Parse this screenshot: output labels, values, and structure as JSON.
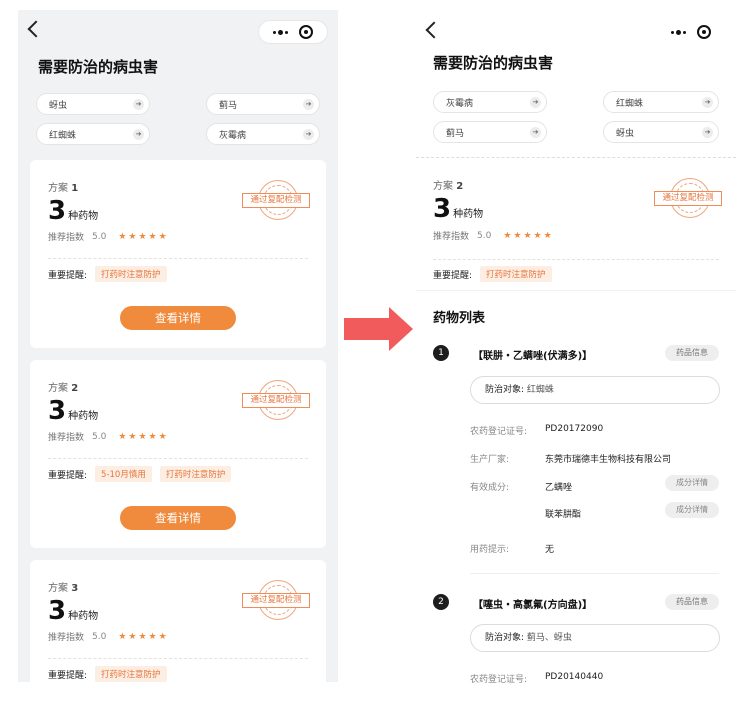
{
  "title": "需要防治的病虫害",
  "left": {
    "chips": [
      "蚜虫",
      "蓟马",
      "红蜘蛛",
      "灰霉病"
    ],
    "plans": [
      {
        "label": "方案",
        "num": "1",
        "count": "3",
        "unit": "种药物",
        "score_label": "推荐指数",
        "score": "5.0",
        "stars": "★★★★★",
        "remind_label": "重要提醒:",
        "tags": [
          "打药时注意防护"
        ],
        "stamp": "通过复配检测",
        "button": "查看详情"
      },
      {
        "label": "方案",
        "num": "2",
        "count": "3",
        "unit": "种药物",
        "score_label": "推荐指数",
        "score": "5.0",
        "stars": "★★★★★",
        "remind_label": "重要提醒:",
        "tags": [
          "5-10月慎用",
          "打药时注意防护"
        ],
        "stamp": "通过复配检测",
        "button": "查看详情"
      },
      {
        "label": "方案",
        "num": "3",
        "count": "3",
        "unit": "种药物",
        "score_label": "推荐指数",
        "score": "5.0",
        "stars": "★★★★★",
        "remind_label": "重要提醒:",
        "tags": [
          "打药时注意防护"
        ],
        "stamp": "通过复配检测"
      }
    ]
  },
  "right": {
    "chips": [
      "灰霉病",
      "红蜘蛛",
      "蓟马",
      "蚜虫"
    ],
    "plan": {
      "label": "方案",
      "num": "2",
      "count": "3",
      "unit": "种药物",
      "score_label": "推荐指数",
      "score": "5.0",
      "stars": "★★★★★",
      "remind_label": "重要提醒:",
      "tags": [
        "打药时注意防护"
      ],
      "stamp": "通过复配检测"
    },
    "list_title": "药物列表",
    "meds": [
      {
        "index": "1",
        "name": "【联肼・乙螨唑(伏满多)】",
        "info_button": "药品信息",
        "target_label": "防治对象:",
        "target_value": "红蜘蛛",
        "reg_label": "农药登记证号:",
        "reg_value": "PD20172090",
        "maker_label": "生产厂家:",
        "maker_value": "东莞市瑞德丰生物科技有限公司",
        "ingredient_label": "有效成分:",
        "ingredients": [
          "乙螨唑",
          "联苯肼酯"
        ],
        "ingredient_button": "成分详情",
        "tip_label": "用药提示:",
        "tip_value": "无"
      },
      {
        "index": "2",
        "name": "【噻虫・高氯氟(方向盘)】",
        "info_button": "药品信息",
        "target_label": "防治对象:",
        "target_value": "蓟马、蚜虫",
        "reg_label": "农药登记证号:",
        "reg_value": "PD20140440"
      }
    ]
  },
  "colors": {
    "accent": "#f08a3c",
    "arrow": "#f25b5b",
    "left_bg": "#f1f2f3"
  },
  "icons": {
    "back": "back-icon",
    "more": "more-dots-icon",
    "target": "target-icon",
    "chip_arrow": "arrow-right-icon"
  }
}
